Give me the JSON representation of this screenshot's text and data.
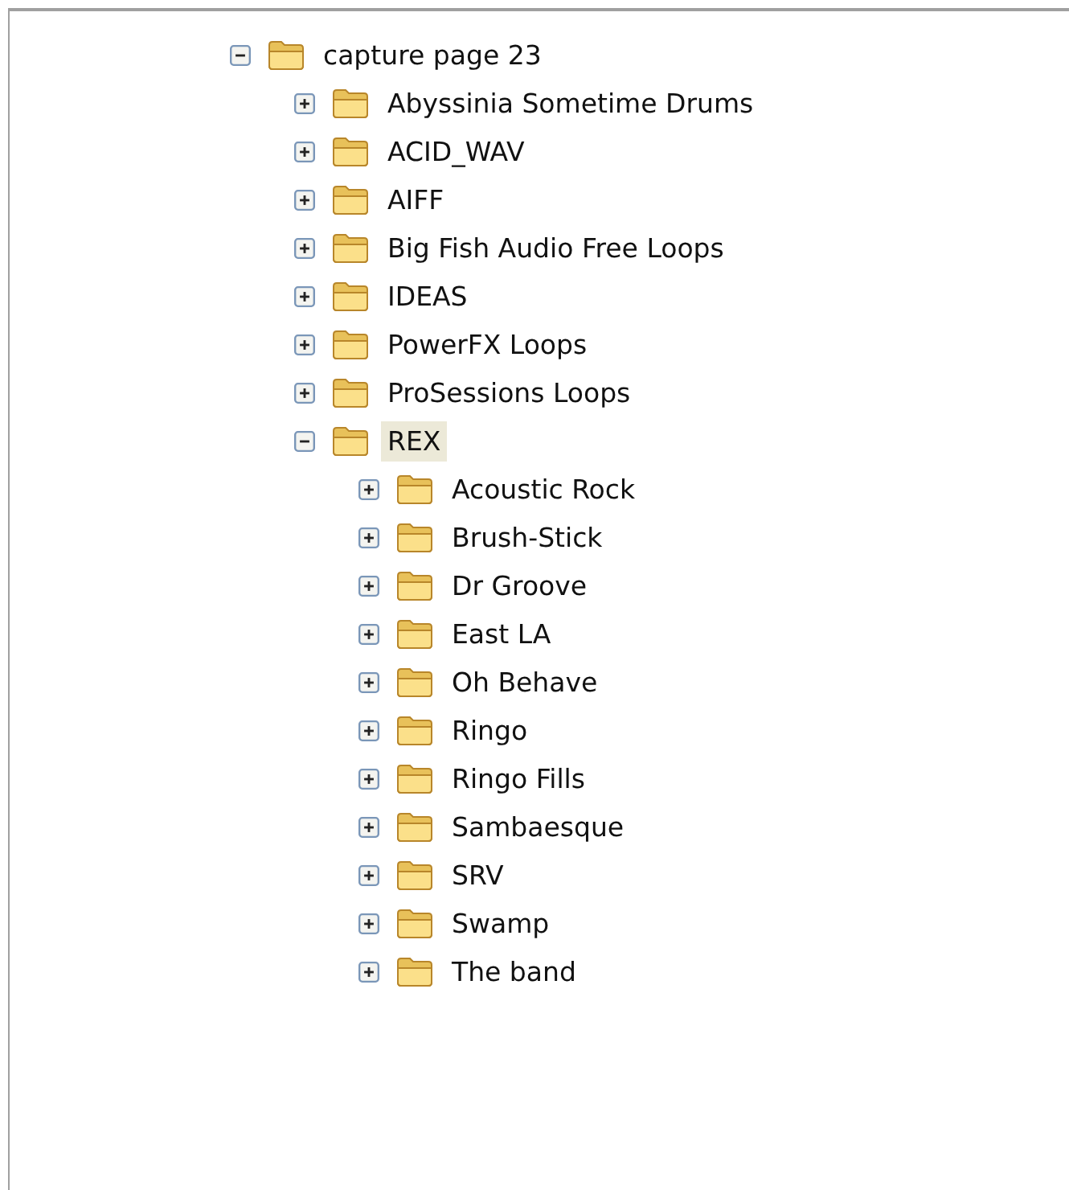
{
  "tree": [
    {
      "label": "capture page 23",
      "expanded": true,
      "selected": false,
      "children": [
        {
          "label": "Abyssinia Sometime Drums",
          "expanded": false,
          "selected": false
        },
        {
          "label": "ACID_WAV",
          "expanded": false,
          "selected": false
        },
        {
          "label": "AIFF",
          "expanded": false,
          "selected": false
        },
        {
          "label": "Big Fish Audio Free Loops",
          "expanded": false,
          "selected": false
        },
        {
          "label": "IDEAS",
          "expanded": false,
          "selected": false
        },
        {
          "label": "PowerFX Loops",
          "expanded": false,
          "selected": false
        },
        {
          "label": "ProSessions Loops",
          "expanded": false,
          "selected": false
        },
        {
          "label": "REX",
          "expanded": true,
          "selected": true,
          "children": [
            {
              "label": "Acoustic Rock",
              "expanded": false,
              "selected": false
            },
            {
              "label": "Brush-Stick",
              "expanded": false,
              "selected": false
            },
            {
              "label": "Dr Groove",
              "expanded": false,
              "selected": false
            },
            {
              "label": "East LA",
              "expanded": false,
              "selected": false
            },
            {
              "label": "Oh Behave",
              "expanded": false,
              "selected": false
            },
            {
              "label": "Ringo",
              "expanded": false,
              "selected": false
            },
            {
              "label": "Ringo Fills",
              "expanded": false,
              "selected": false
            },
            {
              "label": "Sambaesque",
              "expanded": false,
              "selected": false
            },
            {
              "label": "SRV",
              "expanded": false,
              "selected": false
            },
            {
              "label": "Swamp",
              "expanded": false,
              "selected": false
            },
            {
              "label": "The band",
              "expanded": false,
              "selected": false
            }
          ]
        }
      ]
    }
  ]
}
